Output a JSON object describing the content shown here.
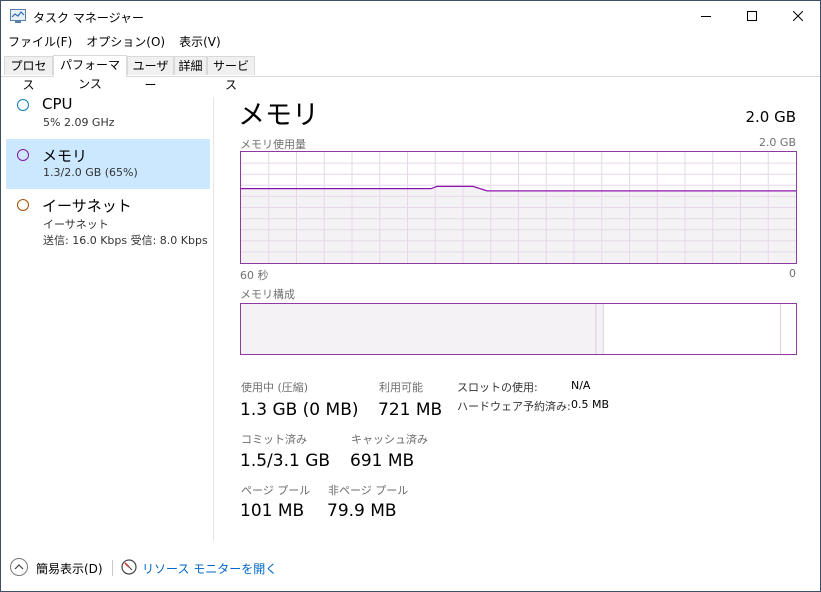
{
  "window": {
    "title": "タスク マネージャー"
  },
  "menu": [
    "ファイル(F)",
    "オプション(O)",
    "表示(V)"
  ],
  "tabs": [
    "プロセス",
    "パフォーマンス",
    "ユーザー",
    "詳細",
    "サービス"
  ],
  "active_tab_index": 1,
  "sidebar": {
    "items": [
      {
        "name": "CPU",
        "sub1": "5%  2.09 GHz",
        "sub2": "",
        "color": "#117dbb",
        "selected": false
      },
      {
        "name": "メモリ",
        "sub1": "1.3/2.0 GB (65%)",
        "sub2": "",
        "color": "#8b12ae",
        "selected": true
      },
      {
        "name": "イーサネット",
        "sub1": "イーサネット",
        "sub2": "送信: 16.0 Kbps  受信: 8.0 Kbps",
        "color": "#a74f01",
        "selected": false
      }
    ]
  },
  "main": {
    "title": "メモリ",
    "total": "2.0 GB",
    "usage_graph": {
      "label": "メモリ使用量",
      "max_label": "2.0 GB",
      "time_left": "60 秒",
      "time_right": "0",
      "usage_fraction_start": 0.67,
      "usage_fraction_bump": 0.69,
      "usage_fraction_end": 0.65,
      "line_color": "#8b12ae",
      "fill_color": "#f4f2f4"
    },
    "composition": {
      "label": "メモリ構成",
      "in_use_fraction": 0.64,
      "modified_fraction": 0.013,
      "standby_fraction": 0.32,
      "free_fraction": 0.027
    },
    "stats": {
      "in_use_label": "使用中 (圧縮)",
      "in_use_value": "1.3 GB (0 MB)",
      "available_label": "利用可能",
      "available_value": "721 MB",
      "committed_label": "コミット済み",
      "committed_value": "1.5/3.1 GB",
      "cached_label": "キャッシュ済み",
      "cached_value": "691 MB",
      "paged_label": "ページ プール",
      "paged_value": "101 MB",
      "nonpaged_label": "非ページ プール",
      "nonpaged_value": "79.9 MB",
      "slots_label": "スロットの使用:",
      "slots_value": "N/A",
      "hw_reserved_label": "ハードウェア予約済み:",
      "hw_reserved_value": "0.5 MB"
    }
  },
  "footer": {
    "fewer_details": "簡易表示(D)",
    "resource_monitor": "リソース モニターを開く"
  }
}
